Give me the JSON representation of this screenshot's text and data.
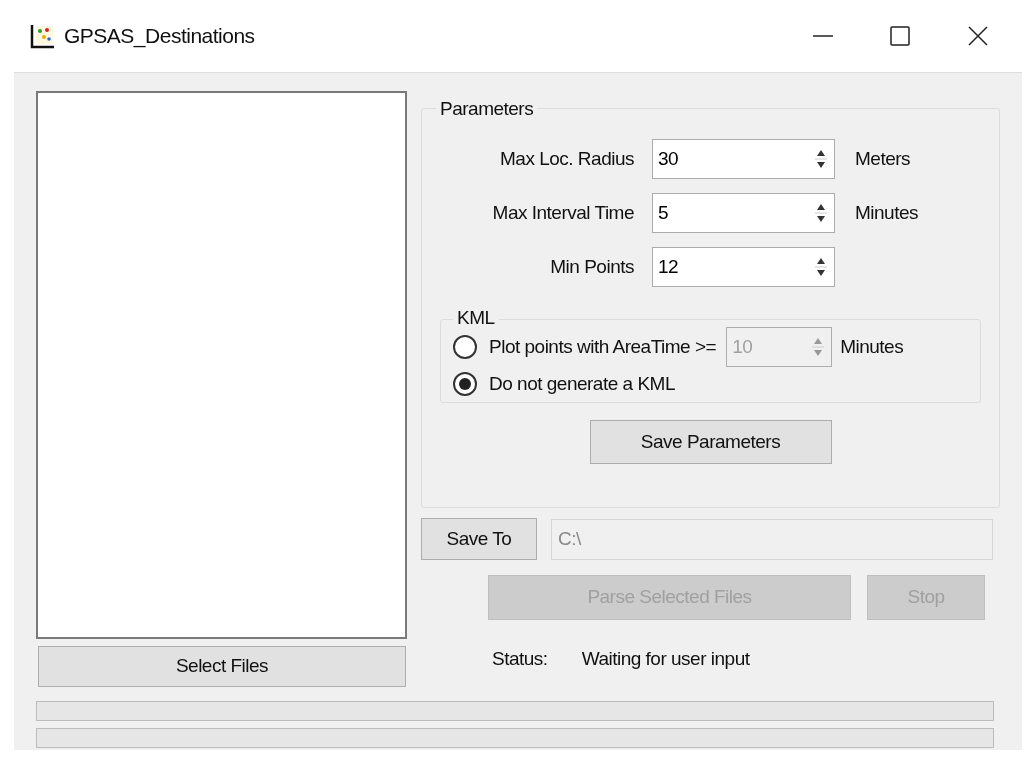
{
  "window": {
    "title": "GPSAS_Destinations"
  },
  "file_list": {
    "button": "Select Files"
  },
  "parameters": {
    "title": "Parameters",
    "fields": [
      {
        "label": "Max Loc. Radius",
        "value": "30",
        "unit": "Meters"
      },
      {
        "label": "Max Interval Time",
        "value": "5",
        "unit": "Minutes"
      },
      {
        "label": "Min Points",
        "value": "12"
      }
    ],
    "kml": {
      "title": "KML",
      "options": [
        {
          "kind": "threshold",
          "label": "Plot points with AreaTime >=",
          "value": "10",
          "unit": "Minutes",
          "disabled": true,
          "selected": false
        },
        {
          "kind": "plain",
          "label": "Do not generate a KML",
          "selected": true
        }
      ]
    },
    "button": "Save Parameters"
  },
  "save_to": {
    "button": "Save To",
    "path": "C:\\"
  },
  "actions": [
    {
      "label": "Parse Selected Files",
      "disabled": true
    },
    {
      "label": "Stop",
      "disabled": true
    }
  ],
  "status": {
    "label": "Status:",
    "value": "Waiting for user input"
  },
  "progress_bars": [
    {
      "level": 0
    },
    {
      "level": 0
    }
  ]
}
